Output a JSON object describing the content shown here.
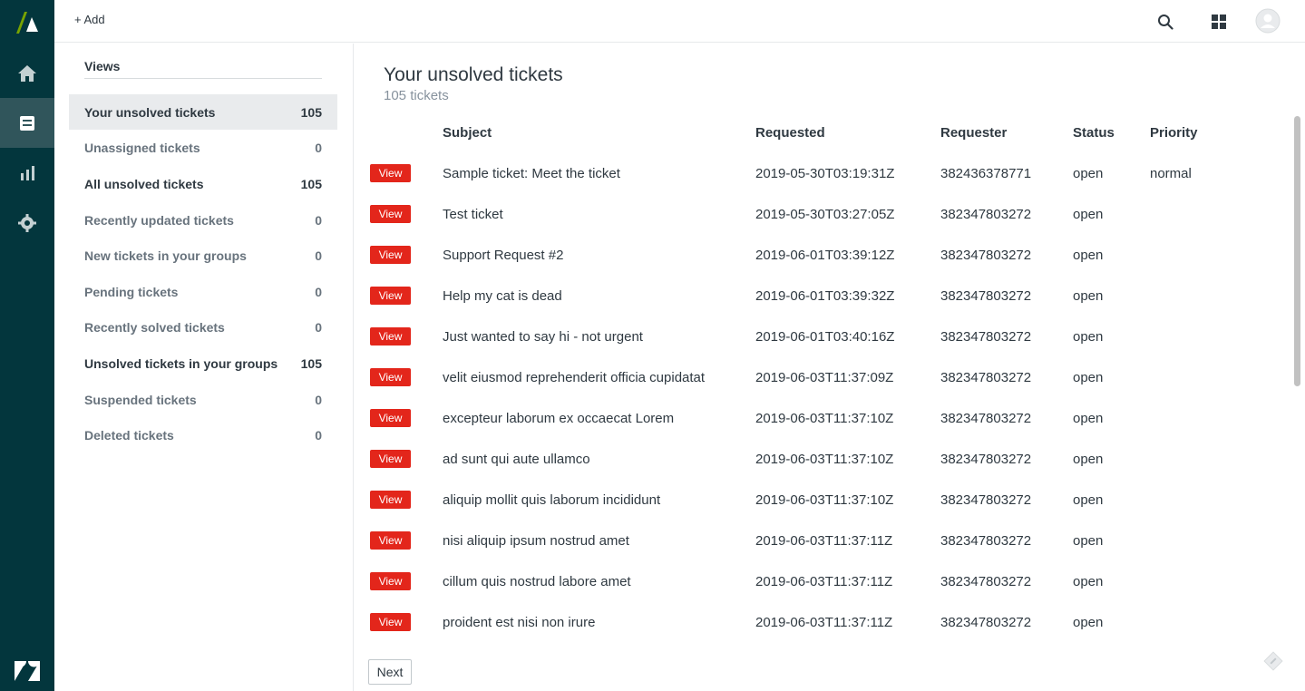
{
  "topbar": {
    "add_label": "+ Add",
    "icons": [
      "search-icon",
      "apps-grid-icon",
      "user-avatar-icon"
    ]
  },
  "rail": {
    "items": [
      "home-icon",
      "views-icon",
      "reporting-icon",
      "settings-icon"
    ],
    "active": "views-icon"
  },
  "views": {
    "title": "Views",
    "items": [
      {
        "label": "Your unsolved tickets",
        "count": "105"
      },
      {
        "label": "Unassigned tickets",
        "count": "0"
      },
      {
        "label": "All unsolved tickets",
        "count": "105"
      },
      {
        "label": "Recently updated tickets",
        "count": "0"
      },
      {
        "label": "New tickets in your groups",
        "count": "0"
      },
      {
        "label": "Pending tickets",
        "count": "0"
      },
      {
        "label": "Recently solved tickets",
        "count": "0"
      },
      {
        "label": "Unsolved tickets in your groups",
        "count": "105"
      },
      {
        "label": "Suspended tickets",
        "count": "0"
      },
      {
        "label": "Deleted tickets",
        "count": "0"
      }
    ]
  },
  "main": {
    "title": "Your unsolved tickets",
    "subtitle": "105 tickets",
    "columns": {
      "subject": "Subject",
      "requested": "Requested",
      "requester": "Requester",
      "status": "Status",
      "priority": "Priority"
    },
    "view_label": "View",
    "next_label": "Next",
    "rows": [
      {
        "subject": "Sample ticket: Meet the ticket",
        "requested": "2019-05-30T03:19:31Z",
        "requester": "382436378771",
        "status": "open",
        "priority": "normal"
      },
      {
        "subject": "Test ticket",
        "requested": "2019-05-30T03:27:05Z",
        "requester": "382347803272",
        "status": "open",
        "priority": ""
      },
      {
        "subject": "Support Request #2",
        "requested": "2019-06-01T03:39:12Z",
        "requester": "382347803272",
        "status": "open",
        "priority": ""
      },
      {
        "subject": "Help my cat is dead",
        "requested": "2019-06-01T03:39:32Z",
        "requester": "382347803272",
        "status": "open",
        "priority": ""
      },
      {
        "subject": "Just wanted to say hi - not urgent",
        "requested": "2019-06-01T03:40:16Z",
        "requester": "382347803272",
        "status": "open",
        "priority": ""
      },
      {
        "subject": "velit eiusmod reprehenderit officia cupidatat",
        "requested": "2019-06-03T11:37:09Z",
        "requester": "382347803272",
        "status": "open",
        "priority": ""
      },
      {
        "subject": "excepteur laborum ex occaecat Lorem",
        "requested": "2019-06-03T11:37:10Z",
        "requester": "382347803272",
        "status": "open",
        "priority": ""
      },
      {
        "subject": "ad sunt qui aute ullamco",
        "requested": "2019-06-03T11:37:10Z",
        "requester": "382347803272",
        "status": "open",
        "priority": ""
      },
      {
        "subject": "aliquip mollit quis laborum incididunt",
        "requested": "2019-06-03T11:37:10Z",
        "requester": "382347803272",
        "status": "open",
        "priority": ""
      },
      {
        "subject": "nisi aliquip ipsum nostrud amet",
        "requested": "2019-06-03T11:37:11Z",
        "requester": "382347803272",
        "status": "open",
        "priority": ""
      },
      {
        "subject": "cillum quis nostrud labore amet",
        "requested": "2019-06-03T11:37:11Z",
        "requester": "382347803272",
        "status": "open",
        "priority": ""
      },
      {
        "subject": "proident est nisi non irure",
        "requested": "2019-06-03T11:37:11Z",
        "requester": "382347803272",
        "status": "open",
        "priority": ""
      }
    ]
  },
  "colors": {
    "rail": "#03363d",
    "rail_active": "#30555b",
    "view_button": "#e3261b",
    "logo_green": "#78a300"
  }
}
